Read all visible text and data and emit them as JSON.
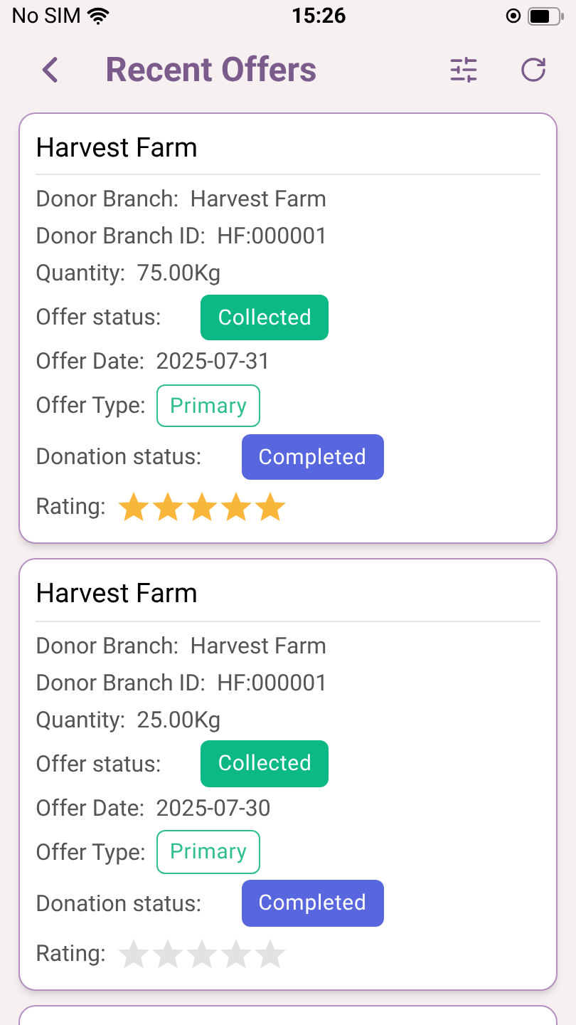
{
  "status_bar": {
    "carrier": "No SIM",
    "time": "15:26"
  },
  "header": {
    "title": "Recent Offers"
  },
  "offers": [
    {
      "title": "Harvest Farm",
      "fields": [
        {
          "kind": "text",
          "label": "Donor Branch:",
          "value": "Harvest Farm"
        },
        {
          "kind": "text",
          "label": "Donor Branch ID:",
          "value": "HF:000001"
        },
        {
          "kind": "text",
          "label": "Quantity:",
          "value": "75.00Kg"
        },
        {
          "kind": "filled",
          "label": "Offer status:",
          "value": "Collected",
          "color": "#0cb985"
        },
        {
          "kind": "text",
          "label": "Offer Date:",
          "value": "2025-07-31"
        },
        {
          "kind": "outline",
          "label": "Offer Type:",
          "value": "Primary",
          "color": "#2fbf8f"
        },
        {
          "kind": "filled",
          "label": "Donation status:",
          "value": "Completed",
          "color": "#5867dd"
        },
        {
          "kind": "rating",
          "label": "Rating:",
          "stars": 5
        }
      ]
    },
    {
      "title": "Harvest Farm",
      "fields": [
        {
          "kind": "text",
          "label": "Donor Branch:",
          "value": "Harvest Farm"
        },
        {
          "kind": "text",
          "label": "Donor Branch ID:",
          "value": "HF:000001"
        },
        {
          "kind": "text",
          "label": "Quantity:",
          "value": "25.00Kg"
        },
        {
          "kind": "filled",
          "label": "Offer status:",
          "value": "Collected",
          "color": "#0cb985"
        },
        {
          "kind": "text",
          "label": "Offer Date:",
          "value": "2025-07-30"
        },
        {
          "kind": "outline",
          "label": "Offer Type:",
          "value": "Primary",
          "color": "#2fbf8f"
        },
        {
          "kind": "filled",
          "label": "Donation status:",
          "value": "Completed",
          "color": "#5867dd"
        },
        {
          "kind": "rating",
          "label": "Rating:",
          "stars": 0
        }
      ]
    }
  ]
}
